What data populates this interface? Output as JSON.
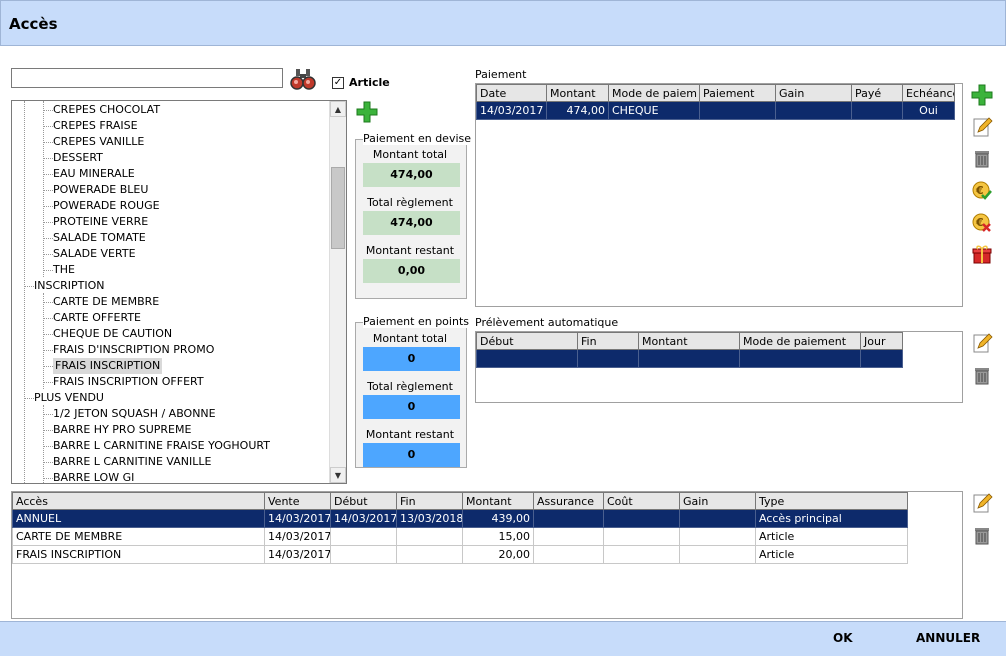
{
  "window": {
    "title": "Accès"
  },
  "search": {
    "value": "",
    "placeholder": ""
  },
  "article_filter": {
    "label": "Article",
    "checked": true,
    "check_mark": "✓"
  },
  "tree": {
    "items": [
      {
        "label": "CREPES CHOCOLAT",
        "level": 2
      },
      {
        "label": "CREPES FRAISE",
        "level": 2
      },
      {
        "label": "CREPES VANILLE",
        "level": 2
      },
      {
        "label": "DESSERT",
        "level": 2
      },
      {
        "label": "EAU MINERALE",
        "level": 2
      },
      {
        "label": "POWERADE BLEU",
        "level": 2
      },
      {
        "label": "POWERADE ROUGE",
        "level": 2
      },
      {
        "label": "PROTEINE VERRE",
        "level": 2
      },
      {
        "label": "SALADE TOMATE",
        "level": 2
      },
      {
        "label": "SALADE VERTE",
        "level": 2
      },
      {
        "label": "THE",
        "level": 2
      },
      {
        "label": "INSCRIPTION",
        "level": 1
      },
      {
        "label": "CARTE DE MEMBRE",
        "level": 2
      },
      {
        "label": "CARTE OFFERTE",
        "level": 2
      },
      {
        "label": "CHEQUE DE CAUTION",
        "level": 2
      },
      {
        "label": "FRAIS D'INSCRIPTION PROMO",
        "level": 2
      },
      {
        "label": "FRAIS INSCRIPTION",
        "level": 2,
        "selected": true
      },
      {
        "label": "FRAIS INSCRIPTION OFFERT",
        "level": 2
      },
      {
        "label": "PLUS VENDU",
        "level": 1
      },
      {
        "label": "1/2 JETON SQUASH / ABONNE",
        "level": 2
      },
      {
        "label": "BARRE HY PRO SUPREME",
        "level": 2
      },
      {
        "label": "BARRE L CARNITINE FRAISE YOGHOURT",
        "level": 2
      },
      {
        "label": "BARRE L CARNITINE VANILLE",
        "level": 2
      },
      {
        "label": "BARRE LOW GI",
        "level": 2
      }
    ]
  },
  "devise": {
    "title": "Paiement en devise",
    "total_label": "Montant total",
    "total_value": "474,00",
    "reglement_label": "Total règlement",
    "reglement_value": "474,00",
    "restant_label": "Montant restant",
    "restant_value": "0,00"
  },
  "points": {
    "title": "Paiement en points",
    "total_label": "Montant total",
    "total_value": "0",
    "reglement_label": "Total règlement",
    "reglement_value": "0",
    "restant_label": "Montant restant",
    "restant_value": "0"
  },
  "paiement": {
    "title": "Paiement",
    "columns": [
      "Date",
      "Montant",
      "Mode de paiem",
      "Paiement",
      "Gain",
      "Payé",
      "Echéance"
    ],
    "rows": [
      [
        "14/03/2017",
        "474,00",
        "CHEQUE",
        "",
        "",
        "",
        "Oui"
      ]
    ]
  },
  "prelevement": {
    "title": "Prélèvement automatique",
    "columns": [
      "Début",
      "Fin",
      "Montant",
      "Mode de paiement",
      "Jour"
    ],
    "rows": [
      [
        "",
        "",
        "",
        "",
        ""
      ]
    ]
  },
  "acces": {
    "columns": [
      "Accès",
      "Vente",
      "Début",
      "Fin",
      "Montant",
      "Assurance",
      "Coût",
      "Gain",
      "Type"
    ],
    "rows": [
      [
        "ANNUEL",
        "14/03/2017",
        "14/03/2017",
        "13/03/2018",
        "439,00",
        "",
        "",
        "",
        "Accès principal"
      ],
      [
        "CARTE DE MEMBRE",
        "14/03/2017",
        "",
        "",
        "15,00",
        "",
        "",
        "",
        "Article"
      ],
      [
        "FRAIS INSCRIPTION",
        "14/03/2017",
        "",
        "",
        "20,00",
        "",
        "",
        "",
        "Article"
      ]
    ]
  },
  "footer": {
    "ok_label": "OK",
    "cancel_label": "ANNULER"
  },
  "colors": {
    "title_bar": "#c7dcfa",
    "selection": "#0d2a6b",
    "green_field": "#c6e0c6",
    "blue_field": "#4da6ff"
  }
}
